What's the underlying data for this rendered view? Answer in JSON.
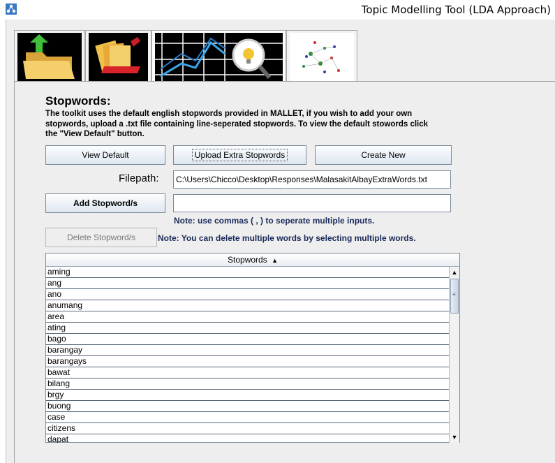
{
  "window": {
    "title": "Topic Modelling Tool (LDA Approach)",
    "app_icon": "network-icon"
  },
  "tabs": [
    {
      "icon": "import-folder-icon"
    },
    {
      "icon": "file-folders-icon"
    },
    {
      "icon": "analysis-chart-icon"
    },
    {
      "icon": "topic-network-icon"
    }
  ],
  "panel": {
    "heading": "Stopwords:",
    "description": "The toolkit uses the default english stopwords provided in MALLET, if you wish to add your own stopwords, upload a .txt file containing line-seperated stopwords. To view the default stowords click the \"View Default\" button."
  },
  "buttons": {
    "view_default": "View Default",
    "upload_extra": "Upload Extra Stopwords",
    "create_new": "Create New",
    "add_stopwords": "Add Stopword/s",
    "delete_stopwords": "Delete Stopword/s"
  },
  "filepath": {
    "label": "Filepath:",
    "value": "C:\\Users\\Chicco\\Desktop\\Responses\\MalasakitAlbayExtraWords.txt"
  },
  "add_field": {
    "value": ""
  },
  "notes": {
    "commas": "Note: use commas ( , ) to seperate multiple inputs.",
    "delete": "Note: You can delete multiple words by selecting multiple words."
  },
  "table": {
    "column_header": "Stopwords",
    "sort_indicator": "▲",
    "rows": [
      "aming",
      "ang",
      "ano",
      "anumang",
      "area",
      "ating",
      "bago",
      "barangay",
      "barangays",
      "bawat",
      "bilang",
      "brgy",
      "buong",
      "case",
      "citizens",
      "dapat"
    ]
  }
}
